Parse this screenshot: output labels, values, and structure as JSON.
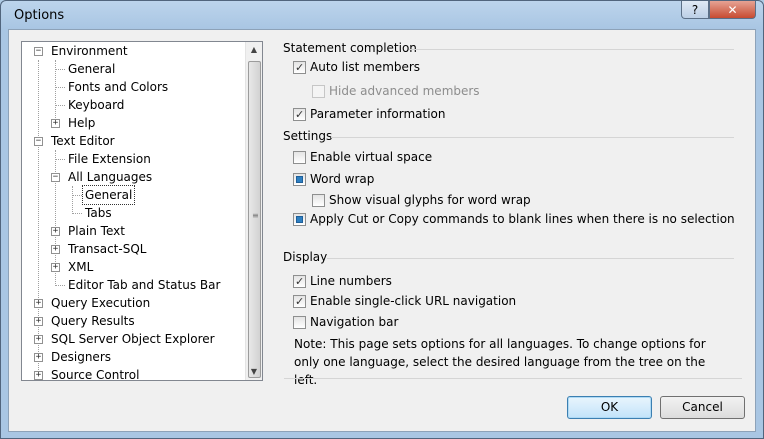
{
  "window": {
    "title": "Options",
    "help_label": "?",
    "close_label": "✕"
  },
  "tree": {
    "nodes": [
      {
        "label": "Environment",
        "expander": "−"
      },
      {
        "label": "General",
        "expander": ""
      },
      {
        "label": "Fonts and Colors",
        "expander": ""
      },
      {
        "label": "Keyboard",
        "expander": ""
      },
      {
        "label": "Help",
        "expander": "+"
      },
      {
        "label": "Text Editor",
        "expander": "−"
      },
      {
        "label": "File Extension",
        "expander": ""
      },
      {
        "label": "All Languages",
        "expander": "−"
      },
      {
        "label": "General",
        "expander": ""
      },
      {
        "label": "Tabs",
        "expander": ""
      },
      {
        "label": "Plain Text",
        "expander": "+"
      },
      {
        "label": "Transact-SQL",
        "expander": "+"
      },
      {
        "label": "XML",
        "expander": "+"
      },
      {
        "label": "Editor Tab and Status Bar",
        "expander": ""
      },
      {
        "label": "Query Execution",
        "expander": "+"
      },
      {
        "label": "Query Results",
        "expander": "+"
      },
      {
        "label": "SQL Server Object Explorer",
        "expander": "+"
      },
      {
        "label": "Designers",
        "expander": "+"
      },
      {
        "label": "Source Control",
        "expander": "+"
      }
    ],
    "selected": "All Languages > General",
    "scroll_up": "▲",
    "scroll_down": "▼",
    "scroll_grip": "≡"
  },
  "statement_completion": {
    "title": "Statement completion",
    "auto_list_members": {
      "label": "Auto list members",
      "checked": true
    },
    "hide_advanced_members": {
      "label": "Hide advanced members",
      "checked": false,
      "disabled": true
    },
    "parameter_information": {
      "label": "Parameter information",
      "checked": true
    }
  },
  "settings": {
    "title": "Settings",
    "enable_virtual_space": {
      "label": "Enable virtual space",
      "checked": false
    },
    "word_wrap": {
      "label": "Word wrap",
      "state": "indeterminate"
    },
    "show_visual_glyphs": {
      "label": "Show visual glyphs for word wrap",
      "checked": false
    },
    "apply_cut_copy": {
      "label": "Apply Cut or Copy commands to blank lines when there is no selection",
      "state": "indeterminate"
    }
  },
  "display": {
    "title": "Display",
    "line_numbers": {
      "label": "Line numbers",
      "checked": true
    },
    "single_click_url": {
      "label": "Enable single-click URL navigation",
      "checked": true
    },
    "navigation_bar": {
      "label": "Navigation bar",
      "checked": false
    }
  },
  "note": "Note: This page sets options for all languages. To change options for only one language, select the desired language from the tree on the left.",
  "buttons": {
    "ok": "OK",
    "cancel": "Cancel"
  }
}
